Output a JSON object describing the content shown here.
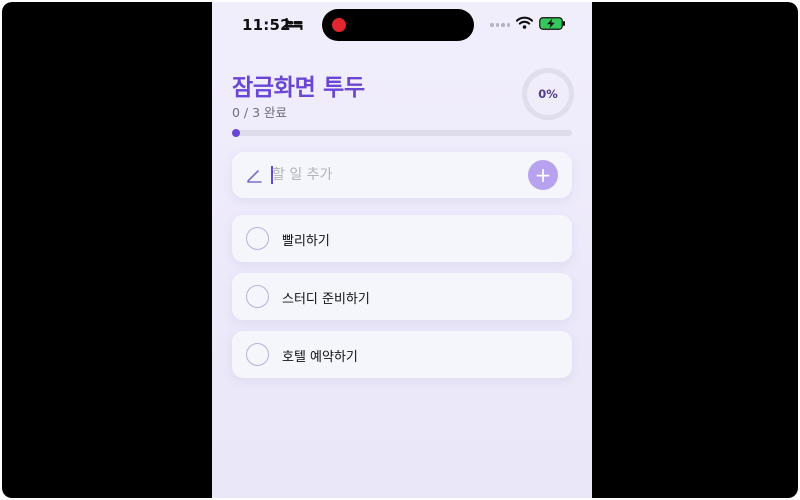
{
  "status_bar": {
    "time": "11:52",
    "icons": [
      "bed-icon",
      "wifi-icon",
      "battery-charging-icon"
    ],
    "recording_color": "#e0262e"
  },
  "header": {
    "title": "잠금화면 투두",
    "progress_text": "0 / 3 완료",
    "percent_label": "0%",
    "progress_fraction": 0
  },
  "add_task": {
    "placeholder": "할 일 추가",
    "value": "",
    "add_button_label": "+"
  },
  "tasks": [
    {
      "label": "빨리하기",
      "done": false
    },
    {
      "label": "스터디 준비하기",
      "done": false
    },
    {
      "label": "호텔 예약하기",
      "done": false
    }
  ],
  "colors": {
    "accent": "#6a46d4",
    "add_button": "#b7a2ef",
    "background": "#f1eefc"
  }
}
